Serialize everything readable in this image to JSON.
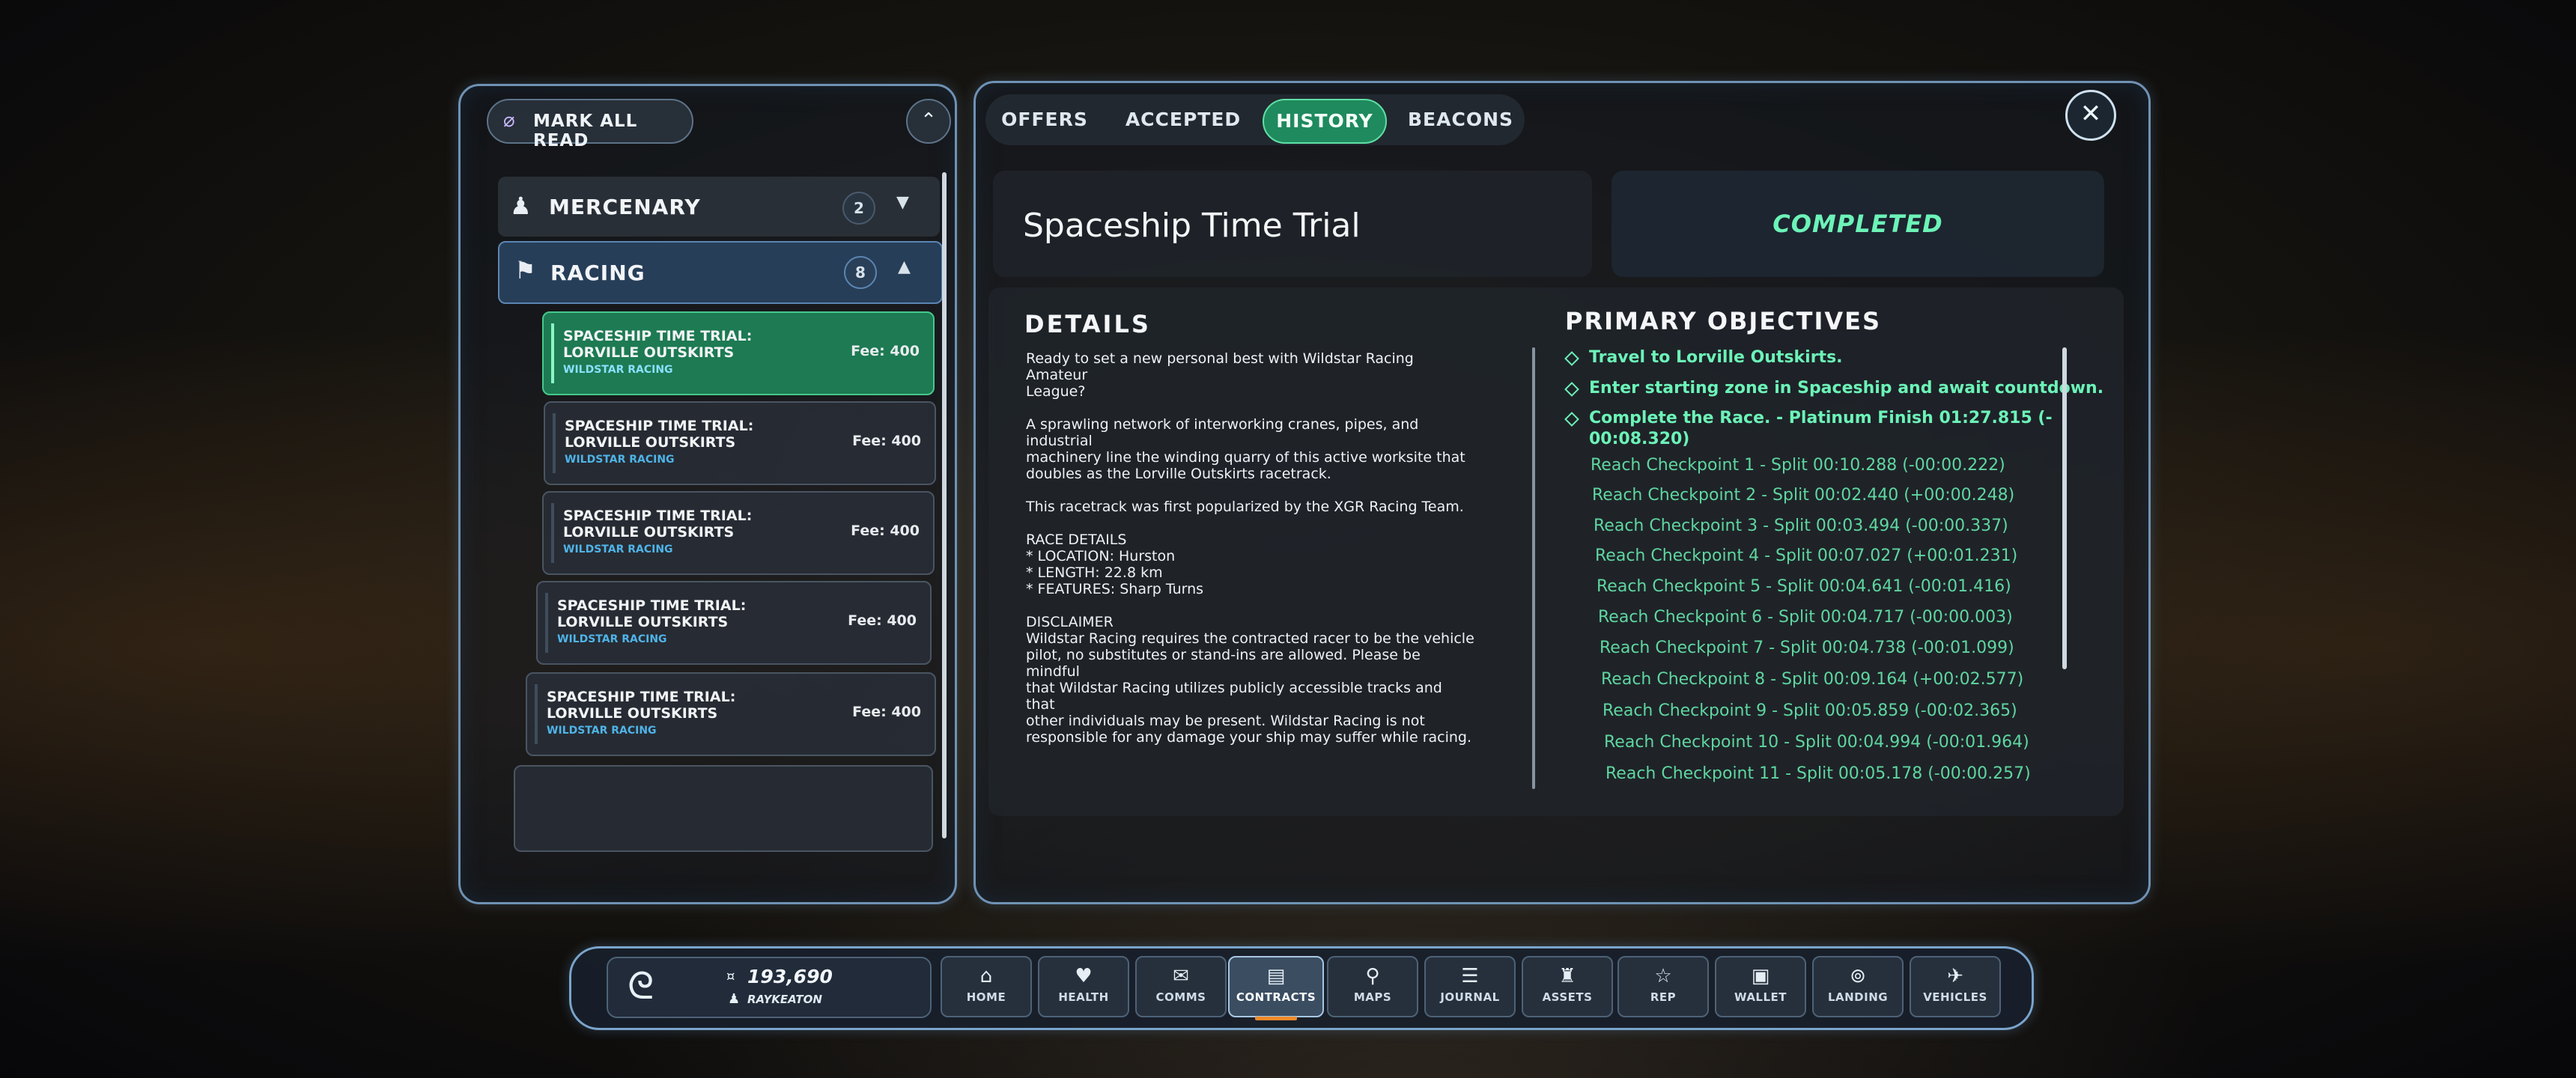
{
  "left_panel": {
    "mark_all_read": "MARK ALL READ",
    "categories": [
      {
        "label": "MERCENARY",
        "count": "2"
      },
      {
        "label": "RACING",
        "count": "8"
      }
    ],
    "contracts": [
      {
        "title": "SPACESHIP TIME TRIAL: LORVILLE OUTSKIRTS",
        "company": "WILDSTAR RACING",
        "fee": "Fee: 400"
      },
      {
        "title": "SPACESHIP TIME TRIAL: LORVILLE OUTSKIRTS",
        "company": "WILDSTAR RACING",
        "fee": "Fee: 400"
      },
      {
        "title": "SPACESHIP TIME TRIAL: LORVILLE OUTSKIRTS",
        "company": "WILDSTAR RACING",
        "fee": "Fee: 400"
      },
      {
        "title": "SPACESHIP TIME TRIAL: LORVILLE OUTSKIRTS",
        "company": "WILDSTAR RACING",
        "fee": "Fee: 400"
      },
      {
        "title": "SPACESHIP TIME TRIAL: LORVILLE OUTSKIRTS",
        "company": "WILDSTAR RACING",
        "fee": "Fee: 400"
      }
    ]
  },
  "tabs": [
    "OFFERS",
    "ACCEPTED",
    "HISTORY",
    "BEACONS"
  ],
  "active_tab": "HISTORY",
  "contract": {
    "title": "Spaceship Time Trial",
    "status": "COMPLETED",
    "details_heading": "DETAILS",
    "details_paragraphs": [
      [
        "Ready to set a new personal best with Wildstar Racing Amateur",
        "League?"
      ],
      [
        "A sprawling network of interworking cranes, pipes, and industrial",
        "machinery line the winding quarry of this active worksite that",
        "doubles as the Lorville Outskirts racetrack."
      ],
      [
        "This racetrack was first popularized by the XGR Racing Team."
      ],
      [
        "RACE DETAILS",
        "* LOCATION: Hurston",
        "* LENGTH: 22.8 km",
        "* FEATURES: Sharp Turns"
      ],
      [
        "DISCLAIMER",
        "Wildstar Racing requires the contracted racer to be the vehicle",
        "pilot, no substitutes or stand-ins are allowed. Please be mindful",
        "that Wildstar Racing utilizes publicly accessible tracks and that",
        "other individuals may be present. Wildstar Racing is not",
        "responsible for any damage your ship may suffer while racing."
      ]
    ],
    "objectives_heading": "PRIMARY OBJECTIVES",
    "objectives": [
      "Travel to Lorville Outskirts.",
      "Enter starting zone in Spaceship and await countdown.",
      "Complete the Race. - Platinum Finish 01:27.815 (-",
      "00:08.320)"
    ],
    "checkpoints": [
      "Reach Checkpoint 1 - Split 00:10.288 (-00:00.222)",
      "Reach Checkpoint 2 - Split 00:02.440 (+00:00.248)",
      "Reach Checkpoint 3 - Split 00:03.494 (-00:00.337)",
      "Reach Checkpoint 4 - Split 00:07.027 (+00:01.231)",
      "Reach Checkpoint 5 - Split 00:04.641 (-00:01.416)",
      "Reach Checkpoint 6 - Split 00:04.717 (-00:00.003)",
      "Reach Checkpoint 7 - Split 00:04.738 (-00:01.099)",
      "Reach Checkpoint 8 - Split 00:09.164 (+00:02.577)",
      "Reach Checkpoint 9 - Split 00:05.859 (-00:02.365)",
      "Reach Checkpoint 10 - Split 00:04.994 (-00:01.964)",
      "Reach Checkpoint 11 - Split 00:05.178 (-00:00.257)"
    ]
  },
  "dock": {
    "balance": "193,690",
    "username": "RAYKEATON",
    "buttons": [
      "HOME",
      "HEALTH",
      "COMMS",
      "CONTRACTS",
      "MAPS",
      "JOURNAL",
      "ASSETS",
      "REP",
      "WALLET",
      "LANDING",
      "VEHICLES"
    ],
    "active": "CONTRACTS"
  },
  "colors": {
    "accent_green": "#1f8a5e",
    "objective_green": "#6cf3b8",
    "frame_blue": "#6f92b4",
    "company_blue": "#4fb4e8"
  }
}
